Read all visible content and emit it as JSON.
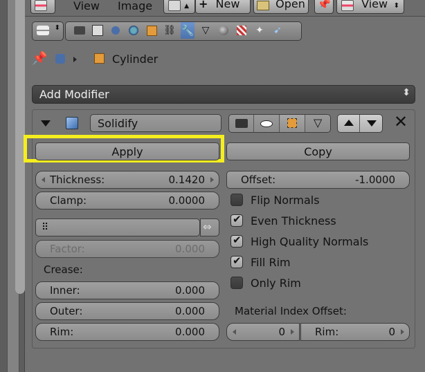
{
  "header": {
    "menu_view": "View",
    "menu_image": "Image",
    "new_label": "New",
    "open_label": "Open",
    "view_label": "View"
  },
  "breadcrumb": {
    "object_name": "Cylinder"
  },
  "add_modifier": {
    "label": "Add Modifier"
  },
  "modifier": {
    "name": "Solidify",
    "apply_label": "Apply",
    "copy_label": "Copy"
  },
  "fields": {
    "thickness_label": "Thickness:",
    "thickness_value": "0.1420",
    "offset_label": "Offset:",
    "offset_value": "-1.0000",
    "clamp_label": "Clamp:",
    "clamp_value": "0.0000",
    "factor_label": "Factor:",
    "factor_value": "0.000",
    "crease_label": "Crease:",
    "inner_label": "Inner:",
    "inner_value": "0.000",
    "outer_label": "Outer:",
    "outer_value": "0.000",
    "rim_label": "Rim:",
    "rim_value": "0.000",
    "material_index_offset_label": "Material Index Offset:",
    "mat_offset_value": "0",
    "mat_rim_label": "Rim:",
    "mat_rim_value": "0"
  },
  "checkboxes": {
    "flip_normals": "Flip Normals",
    "even_thickness": "Even Thickness",
    "high_quality_normals": "High Quality Normals",
    "fill_rim": "Fill Rim",
    "only_rim": "Only Rim"
  },
  "colors": {
    "highlight": "#f5ee1e",
    "active_tab": "#5a82bd"
  }
}
